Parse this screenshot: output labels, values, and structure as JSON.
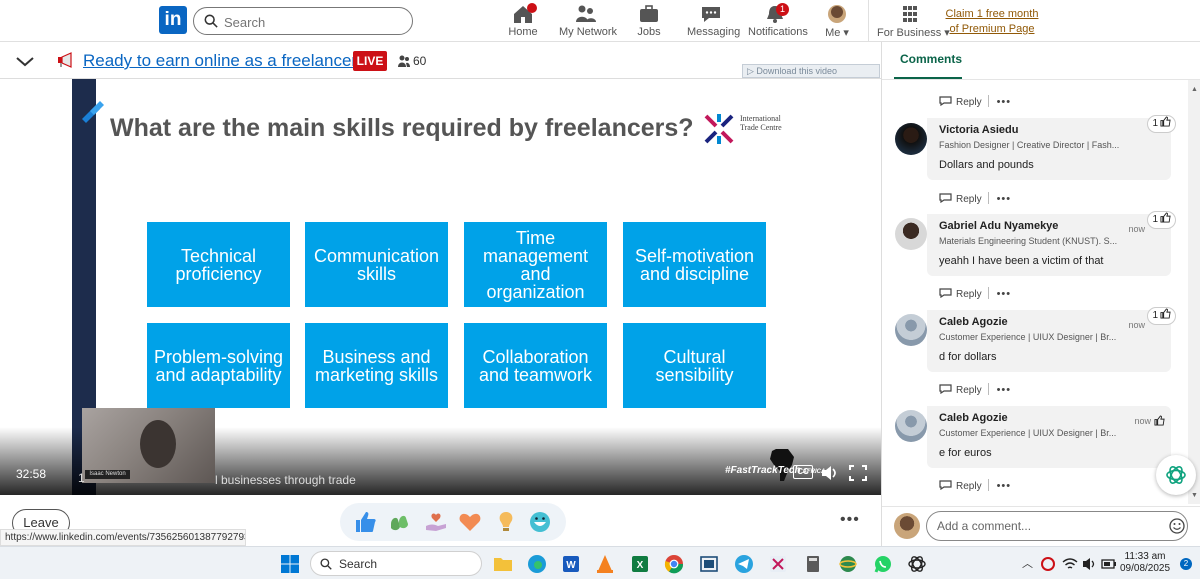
{
  "topnav": {
    "logo": "in",
    "search_placeholder": "Search",
    "items": [
      {
        "label": "Home",
        "icon": "home-icon"
      },
      {
        "label": "My Network",
        "icon": "network-icon"
      },
      {
        "label": "Jobs",
        "icon": "briefcase-icon"
      },
      {
        "label": "Messaging",
        "icon": "messaging-icon"
      },
      {
        "label": "Notifications",
        "icon": "bell-icon",
        "badge": "1"
      },
      {
        "label": "Me",
        "icon": "avatar"
      },
      {
        "label": "For Business",
        "icon": "grid-icon"
      }
    ],
    "premium_line1": "Claim 1 free month",
    "premium_line2": "of Premium Page"
  },
  "event": {
    "title": "Ready to earn online as a freelancer?",
    "live_label": "LIVE",
    "viewers": "60"
  },
  "video": {
    "download_label": "Download this video",
    "slide_title": "What are the main skills required by freelancers?",
    "itc_text": "International Trade Centre",
    "skills": [
      "Technical proficiency",
      "Communication skills",
      "Time management and organization",
      "Self-motivation and discipline",
      "Problem-solving and adaptability",
      "Business and marketing skills",
      "Collaboration and teamwork",
      "Cultural sensibility"
    ],
    "presenter_tag": "Isaac Newton",
    "timecode": "32:58",
    "caption_prefix": "1",
    "caption": "l businesses through trade",
    "brand": "#FastTrackTech",
    "brand_sub": "AFRICA",
    "cc_label": "CC"
  },
  "bottom": {
    "leave_label": "Leave",
    "more_label": "•••",
    "url": "https://www.linkedin.com/events/7356256013877927936"
  },
  "panel": {
    "tab_label": "Comments",
    "reply_label": "Reply",
    "comments": [
      {
        "name": "Victoria Asiedu",
        "role": "Fashion Designer | Creative Director | Fash...",
        "text": "Dollars and pounds",
        "time": "",
        "likes": "1"
      },
      {
        "name": "Gabriel Adu Nyamekye",
        "role": "Materials Engineering Student (KNUST). S...",
        "text": "yeahh I have been a victim of that",
        "time": "now",
        "likes": "1"
      },
      {
        "name": "Caleb Agozie",
        "role": "Customer Experience | UIUX Designer | Br...",
        "text": "d for dollars",
        "time": "now",
        "likes": "1"
      },
      {
        "name": "Caleb Agozie",
        "role": "Customer Experience | UIUX Designer | Br...",
        "text": "e for euros",
        "time": "now",
        "likes": ""
      }
    ],
    "compose_placeholder": "Add a comment..."
  },
  "taskbar": {
    "search_label": "Search",
    "time": "11:33 am",
    "date": "09/08/2025",
    "notif_count": "2"
  },
  "colors": {
    "linkedin_blue": "#0a66c2",
    "live_red": "#cc1016",
    "skill_blue": "#00a2e8",
    "comments_green": "#0b6449"
  }
}
